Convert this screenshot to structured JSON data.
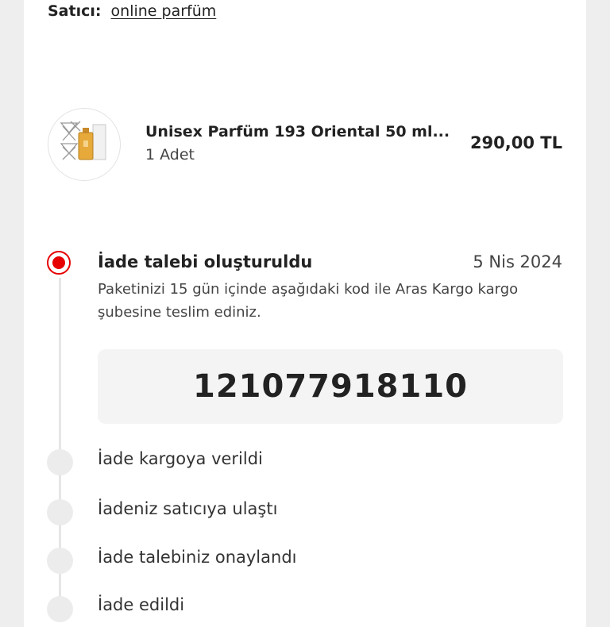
{
  "seller": {
    "label": "Satıcı:",
    "name": "online parfüm"
  },
  "product": {
    "title": "Unisex Parfüm 193 Oriental 50 ml...",
    "quantity": "1 Adet",
    "price": "290,00 TL",
    "image_icon": "perfume-bottle-icon"
  },
  "timeline": {
    "active_step": {
      "title": "İade talebi oluşturuldu",
      "date": "5 Nis 2024",
      "description": "Paketinizi 15 gün içinde aşağıdaki kod ile Aras Kargo kargo şubesine teslim ediniz.",
      "code": "121077918110"
    },
    "pending_steps": [
      {
        "title": "İade kargoya verildi"
      },
      {
        "title": "İadeniz satıcıya ulaştı"
      },
      {
        "title": "İade talebiniz onaylandı"
      },
      {
        "title": "İade edildi"
      }
    ]
  },
  "colors": {
    "accent": "#e60000",
    "pending_dot": "#ececec",
    "code_background": "#f4f4f4"
  }
}
